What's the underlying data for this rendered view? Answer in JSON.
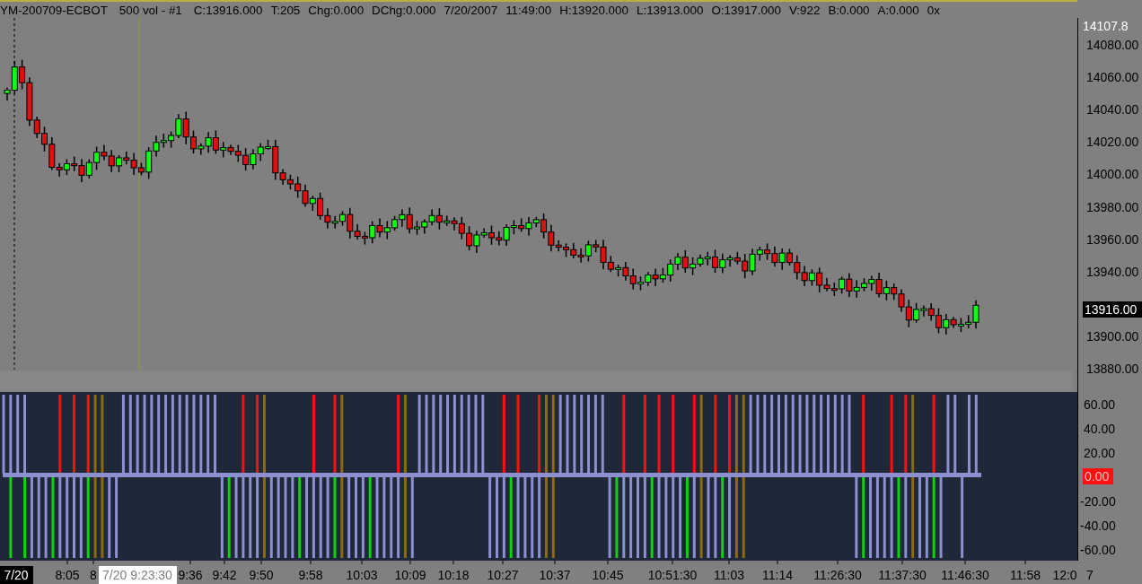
{
  "header": {
    "symbol": "YM-200709-ECBOT",
    "interval": "500 vol - #1",
    "fields": [
      "C:13916.000",
      "T:205",
      "Chg:0.000",
      "DChg:0.000",
      "7/20/2007",
      "11:49:00",
      "H:13920.000",
      "L:13913.000",
      "O:13917.000",
      "V:922",
      "B:0.000",
      "A:0.000",
      "0x"
    ]
  },
  "price_axis": {
    "top_label": "14107.8",
    "ticks": [
      "14080.00",
      "14060.00",
      "14040.00",
      "14020.00",
      "14000.00",
      "13980.00",
      "13960.00",
      "13940.00",
      "13900.00",
      "13880.00"
    ],
    "last_price": "13916.00"
  },
  "indicator_axis": {
    "upper_ticks": [
      "60.00",
      "40.00",
      "20.00"
    ],
    "zero_label": "0.00",
    "lower_ticks": [
      "-20.00",
      "-40.00",
      "-60.00"
    ]
  },
  "time_axis": {
    "labels": [
      {
        "kind": "date",
        "text": "7/20"
      },
      {
        "kind": "time",
        "text": "8:05"
      },
      {
        "kind": "time",
        "text": "8"
      },
      {
        "kind": "cursor",
        "text": "7/20 9:23:30"
      },
      {
        "kind": "time",
        "text": "9:36"
      },
      {
        "kind": "time",
        "text": "9:42"
      },
      {
        "kind": "time",
        "text": "9:50"
      },
      {
        "kind": "time",
        "text": "9:58"
      },
      {
        "kind": "time",
        "text": "10:03"
      },
      {
        "kind": "time",
        "text": "10:09"
      },
      {
        "kind": "time",
        "text": "10:18"
      },
      {
        "kind": "time",
        "text": "10:27"
      },
      {
        "kind": "time",
        "text": "10:37"
      },
      {
        "kind": "time",
        "text": "10:45"
      },
      {
        "kind": "time",
        "text": "10:51:30"
      },
      {
        "kind": "time",
        "text": "11:03"
      },
      {
        "kind": "time",
        "text": "11:14"
      },
      {
        "kind": "time",
        "text": "11:26:30"
      },
      {
        "kind": "time",
        "text": "11:37:30"
      },
      {
        "kind": "time",
        "text": "11:46:30"
      },
      {
        "kind": "time",
        "text": "11:58"
      },
      {
        "kind": "time",
        "text": "12:0"
      },
      {
        "kind": "time",
        "text": "7"
      }
    ]
  }
}
